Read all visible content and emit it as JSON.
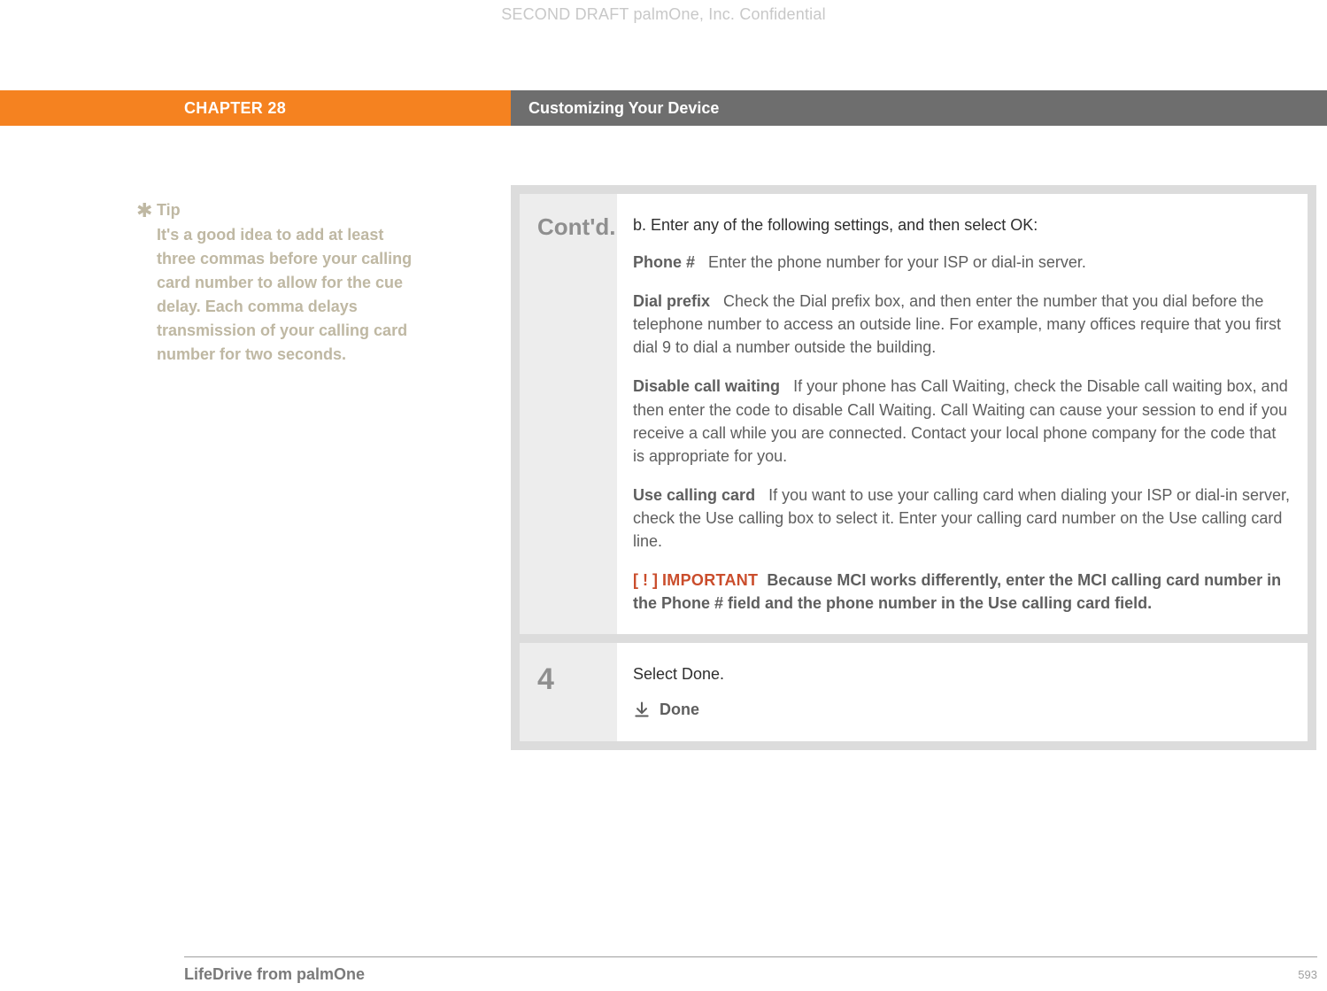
{
  "watermark": "SECOND DRAFT palmOne, Inc.  Confidential",
  "header": {
    "chapter": "CHAPTER 28",
    "title": "Customizing Your Device"
  },
  "tip": {
    "heading": "Tip",
    "body": "It's a good idea to add at least three commas before your calling card number to allow for the cue delay. Each comma delays transmission of your calling card number for two seconds."
  },
  "main": {
    "contd_label": "Cont'd.",
    "intro": "b.  Enter any of the following settings, and then select OK:",
    "items": [
      {
        "term": "Phone #",
        "body": "Enter the phone number for your ISP or dial-in server."
      },
      {
        "term": "Dial prefix",
        "body": "Check the Dial prefix box, and then enter the number that you dial before the telephone number to access an outside line. For example, many offices require that you first dial 9 to dial a number outside the building."
      },
      {
        "term": "Disable call waiting",
        "body": "If your phone has Call Waiting, check the Disable call waiting box, and then enter the code to disable Call Waiting. Call Waiting can cause your session to end if you receive a call while you are connected. Contact your local phone company for the code that is appropriate for you."
      },
      {
        "term": "Use calling card",
        "body": "If you want to use your calling card when dialing your ISP or dial-in server, check the Use calling box to select it. Enter your calling card number on the Use calling card line."
      }
    ],
    "important": {
      "bracket": "[ ! ]",
      "label": "IMPORTANT",
      "text": "Because MCI works differently, enter the MCI calling card number in the Phone # field and the phone number in the Use calling card field."
    },
    "step4": {
      "label": "4",
      "text": "Select Done.",
      "done_label": "Done"
    }
  },
  "footer": {
    "left": "LifeDrive from palmOne",
    "page": "593"
  }
}
